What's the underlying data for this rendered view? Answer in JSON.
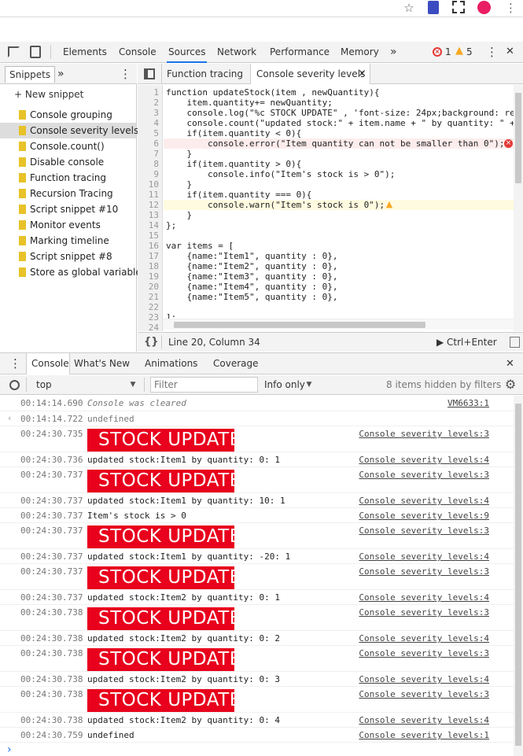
{
  "devtools": {
    "tabs": [
      "Elements",
      "Console",
      "Sources",
      "Network",
      "Performance",
      "Memory"
    ],
    "active_tab": "Sources",
    "more": "»",
    "errors": "1",
    "warnings": "5",
    "menu": "⋮",
    "close": "✕"
  },
  "browser": {
    "icons": [
      "star-icon",
      "extension-icon",
      "screenshot-icon",
      "profile-icon"
    ]
  },
  "snippets": {
    "tab_label": "Snippets",
    "more": "»",
    "new_label": "+ New snippet",
    "selected": "Console severity levels",
    "items": [
      "Console grouping",
      "Console severity levels",
      "Console.count()",
      "Disable console",
      "Function tracing",
      "Recursion Tracing",
      "Script snippet #10",
      "Monitor events",
      "Marking timeline",
      "Script snippet #8",
      "Store as global variable"
    ]
  },
  "editor": {
    "tabs": [
      "Function tracing",
      "Console severity levels"
    ],
    "active_tab": "Console severity levels",
    "tab_close": "×",
    "line_numbers": [
      "1",
      "2",
      "3",
      "4",
      "5",
      "6",
      "7",
      "8",
      "9",
      "10",
      "11",
      "12",
      "13",
      "14",
      "15",
      "16",
      "17",
      "18",
      "19",
      "20",
      "21",
      "22",
      "23",
      "24"
    ],
    "code": [
      "function updateStock(item , newQuantity){",
      "    item.quantity+= newQuantity;",
      "    console.log(\"%c STOCK UPDATE\" , 'font-size: 24px;background: re",
      "    console.count(\"updated stock:\" + item.name + \" by quantity: \" +",
      "    if(item.quantity < 0){",
      "        console.error(\"Item quantity can not be smaller than 0\");",
      "    }",
      "    if(item.quantity > 0){",
      "        console.info(\"Item's stock is > 0\");",
      "    }",
      "    if(item.quantity === 0){",
      "        console.warn(\"Item's stock is 0\");",
      "    }",
      "};",
      "",
      "var items = [",
      "    {name:\"Item1\", quantity : 0},",
      "    {name:\"Item2\", quantity : 0},",
      "    {name:\"Item3\", quantity : 0},",
      "    {name:\"Item4\", quantity : 0},",
      "    {name:\"Item5\", quantity : 0},",
      "",
      "];",
      ""
    ],
    "status_braces": "{}",
    "cursor": "Line 20, Column 34",
    "run_label": "▶ Ctrl+Enter"
  },
  "drawer": {
    "tabs": [
      "Console",
      "What's New",
      "Animations",
      "Coverage"
    ],
    "active_tab": "Console",
    "close": "✕"
  },
  "console_toolbar": {
    "context": "top",
    "filter_placeholder": "Filter",
    "level": "Info only",
    "hidden": "8 items hidden by filters"
  },
  "console": {
    "cleared": {
      "time": "00:14:14.690",
      "text": "Console was cleared",
      "source": "VM6633:1"
    },
    "result": {
      "time": "00:14:14.722",
      "text": "undefined"
    },
    "messages": [
      {
        "time": "00:24:30.735",
        "stock": "STOCK UPDATE",
        "source": "Console severity levels:3"
      },
      {
        "time": "00:24:30.736",
        "text": "updated stock:Item1 by quantity: 0: 1",
        "source": "Console severity levels:4"
      },
      {
        "time": "00:24:30.737",
        "stock": "STOCK UPDATE",
        "source": "Console severity levels:3"
      },
      {
        "time": "00:24:30.737",
        "text": "updated stock:Item1 by quantity: 10: 1",
        "source": "Console severity levels:4"
      },
      {
        "time": "00:24:30.737",
        "text": "Item's stock is > 0",
        "source": "Console severity levels:9"
      },
      {
        "time": "00:24:30.737",
        "stock": "STOCK UPDATE",
        "source": "Console severity levels:3"
      },
      {
        "time": "00:24:30.737",
        "text": "updated stock:Item1 by quantity: -20: 1",
        "source": "Console severity levels:4"
      },
      {
        "time": "00:24:30.737",
        "stock": "STOCK UPDATE",
        "source": "Console severity levels:3"
      },
      {
        "time": "00:24:30.737",
        "text": "updated stock:Item2 by quantity: 0: 1",
        "source": "Console severity levels:4"
      },
      {
        "time": "00:24:30.738",
        "stock": "STOCK UPDATE",
        "source": "Console severity levels:3"
      },
      {
        "time": "00:24:30.738",
        "text": "updated stock:Item2 by quantity: 0: 2",
        "source": "Console severity levels:4"
      },
      {
        "time": "00:24:30.738",
        "stock": "STOCK UPDATE",
        "source": "Console severity levels:3"
      },
      {
        "time": "00:24:30.738",
        "text": "updated stock:Item2 by quantity: 0: 3",
        "source": "Console severity levels:4"
      },
      {
        "time": "00:24:30.738",
        "stock": "STOCK UPDATE",
        "source": "Console severity levels:3"
      },
      {
        "time": "00:24:30.738",
        "text": "updated stock:Item2 by quantity: 0: 4",
        "source": "Console severity levels:4"
      },
      {
        "time": "00:24:30.759",
        "text": "undefined",
        "source": "Console severity levels:1"
      }
    ],
    "prompt": "›"
  },
  "colors": {
    "accent": "#1a73e8",
    "stock_bg": "#e8001c",
    "error": "#e53935",
    "warning": "#f9a825"
  }
}
